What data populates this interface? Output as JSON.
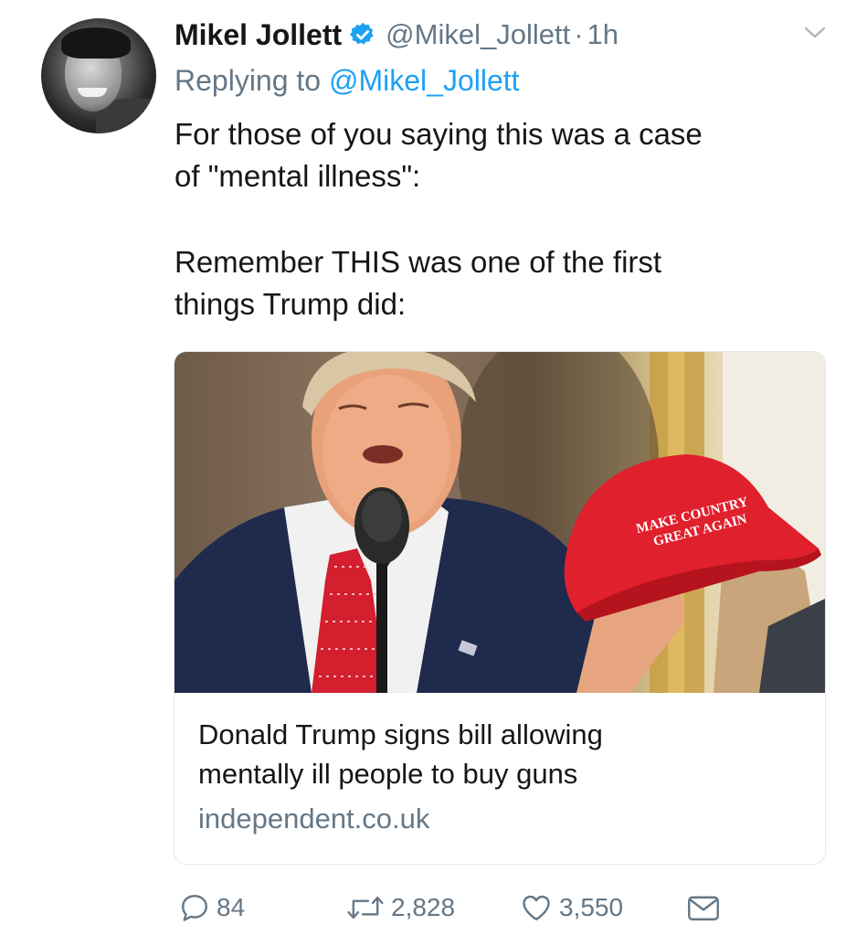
{
  "tweet": {
    "author_name": "Mikel Jollett",
    "handle": "@Mikel_Jollett",
    "separator": "·",
    "time": "1h",
    "replying_prefix": "Replying to",
    "replying_to": "@Mikel_Jollett",
    "text_lines": [
      "For those of you saying this was a case",
      "of \"mental illness\":",
      "Remember THIS was one of the first",
      "things Trump did:"
    ]
  },
  "card": {
    "image_cap_text_1": "MAKE COUNTRY",
    "image_cap_text_2": "GREAT AGAIN",
    "title_line_1": "Donald Trump signs bill allowing",
    "title_line_2": "mentally ill people to buy guns",
    "domain": "independent.co.uk"
  },
  "actions": {
    "replies": "84",
    "retweets": "2,828",
    "likes": "3,550"
  },
  "colors": {
    "text": "#14171a",
    "muted": "#657786",
    "link": "#1da1f2",
    "border": "#e1e8ed"
  },
  "icons": [
    "verified-badge-icon",
    "chevron-down-icon",
    "reply-icon",
    "retweet-icon",
    "like-icon",
    "direct-message-icon"
  ]
}
